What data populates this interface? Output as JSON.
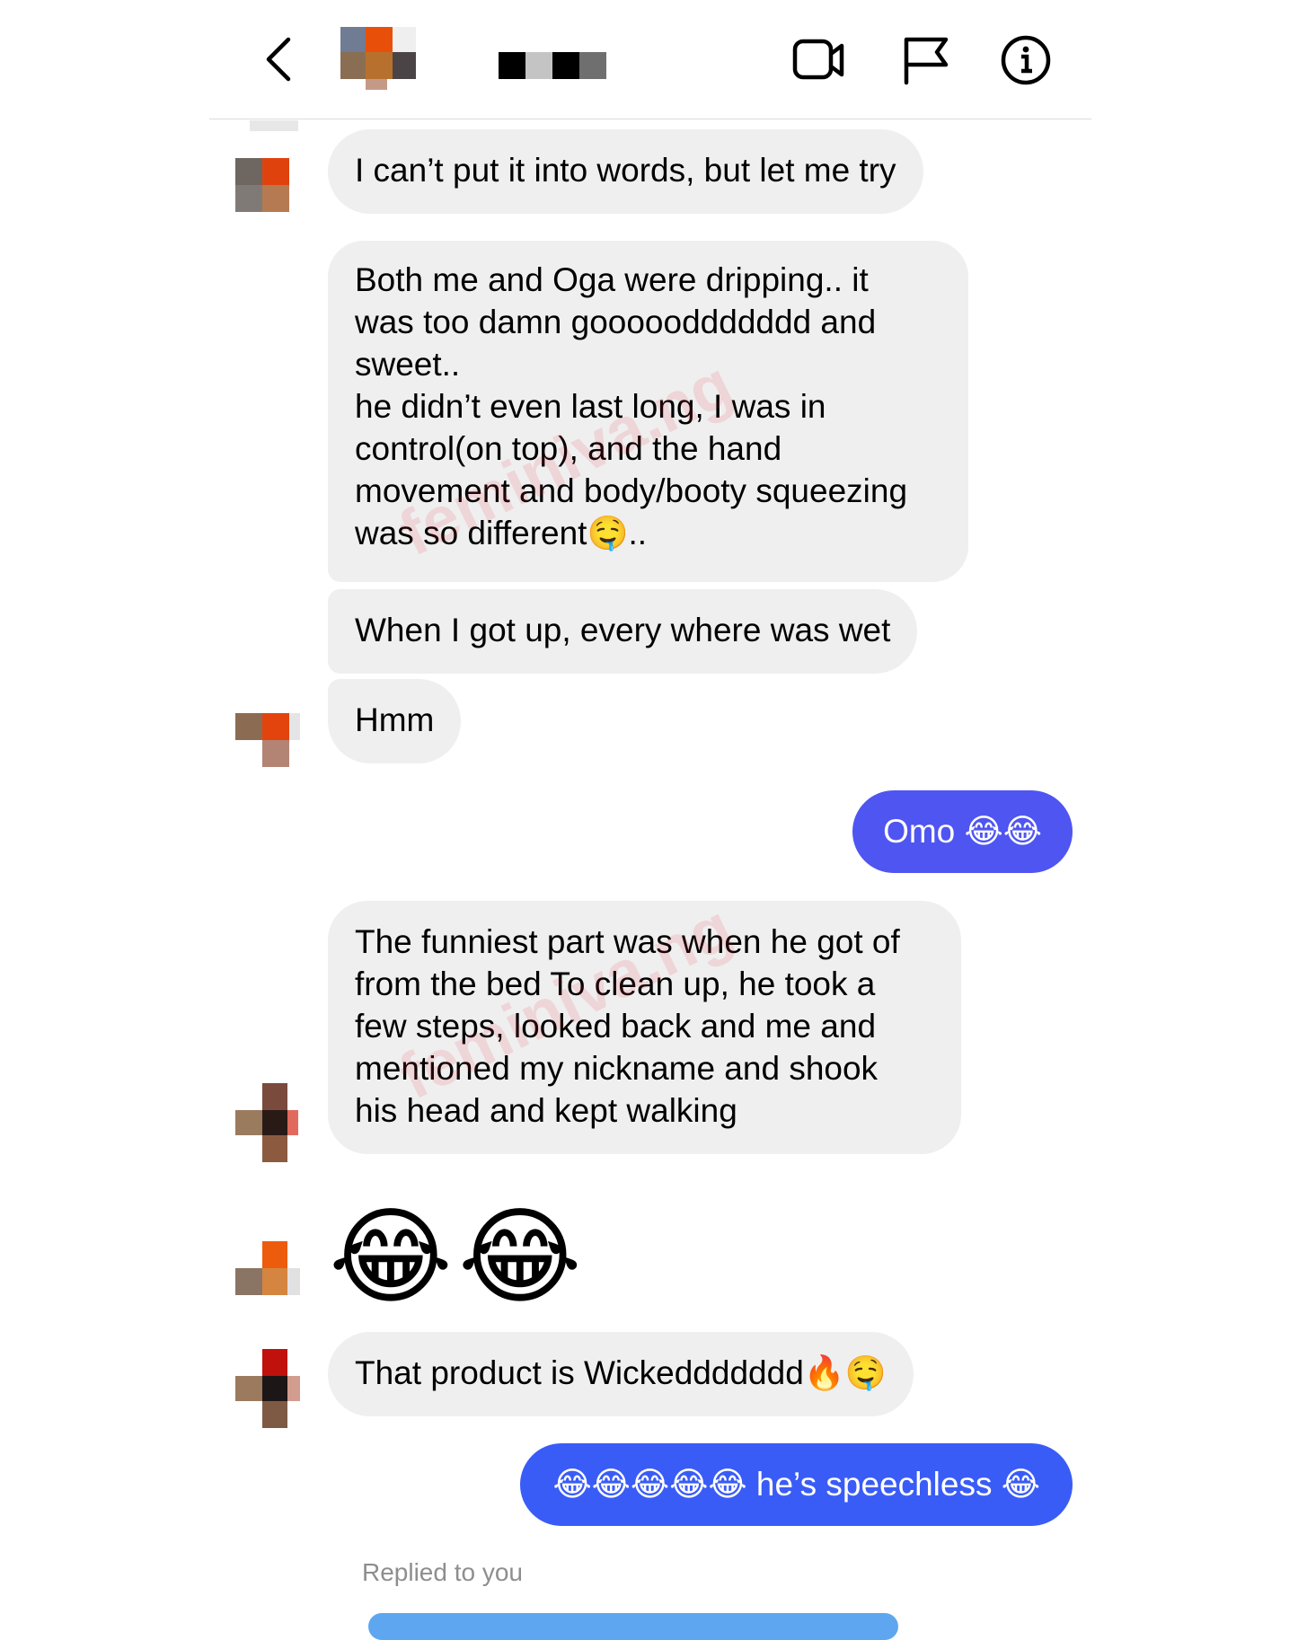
{
  "header": {
    "back_icon": "chevron-left-icon",
    "video_icon": "video-call-icon",
    "flag_icon": "flag-icon",
    "info_icon": "info-icon"
  },
  "messages": [
    {
      "from": "them",
      "text": "I can’t put it into words, but let me try"
    },
    {
      "from": "them",
      "lines": [
        "Both me and Oga were dripping.. it",
        "was too damn goooooddddddd and",
        "sweet..",
        "he didn’t even last long, I was in",
        "control(on top), and the hand",
        "movement and body/booty squeezing",
        "was so different🤤.."
      ]
    },
    {
      "from": "them",
      "text": "When I got up, every where was wet"
    },
    {
      "from": "them",
      "text": "Hmm"
    },
    {
      "from": "me",
      "text": "Omo 😂😂"
    },
    {
      "from": "them",
      "lines": [
        "The funniest part was when he got of",
        "from the bed To clean up, he took a",
        "few steps, looked back and me and",
        "mentioned my nickname and shook",
        "his head and kept walking"
      ]
    },
    {
      "from": "them",
      "emoji_only": "😂😂"
    },
    {
      "from": "them",
      "text": "That product is Wickeddddddd🔥🤤"
    },
    {
      "from": "me",
      "text": "😂😂😂😂😂 he’s speechless 😂"
    }
  ],
  "reply_label": "Replied to you",
  "watermark": "feminiva.ng",
  "colors": {
    "outgoing_bubble": "#4f55f1",
    "outgoing_bubble_2": "#3a5cf6",
    "incoming_bubble": "#efefef",
    "meta_text": "#8e8e8e"
  }
}
